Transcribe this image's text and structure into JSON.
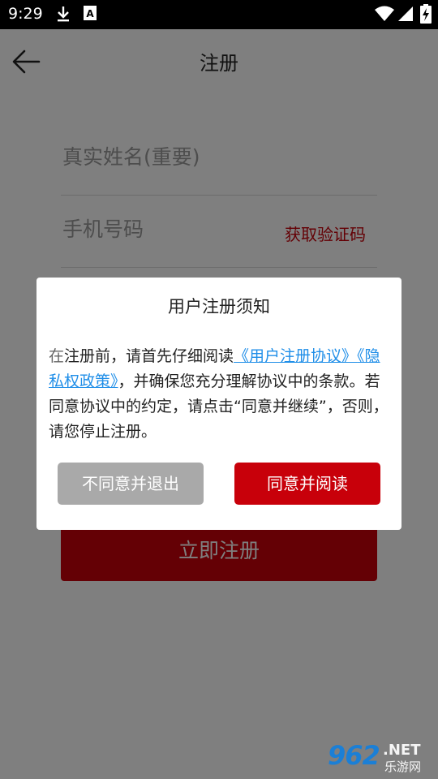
{
  "status_bar": {
    "time": "9:29",
    "icons": [
      "download-icon",
      "a11y-notification-icon",
      "wifi-icon",
      "signal-icon",
      "battery-charging-icon"
    ]
  },
  "app_bar": {
    "title": "注册",
    "back_icon": "arrow-left-icon"
  },
  "form": {
    "name_placeholder": "真实姓名(重要)",
    "phone_placeholder": "手机号码",
    "verify_label": "获取验证码",
    "register_label": "立即注册"
  },
  "dialog": {
    "title": "用户注册须知",
    "body_first_char": "在",
    "body_text_1": "注册前，请首先仔细阅读",
    "link_agreement": "《用户注册协议》",
    "link_privacy": "《隐私权政策》",
    "body_text_2": "，并确保您充分理解协议中的条款。若同意协议中的约定，请点击“同意并继续”，否则，请您停止注册。",
    "disagree_label": "不同意并退出",
    "agree_label": "同意并阅读"
  },
  "watermark": {
    "number": "962",
    "net": ".NET",
    "site": "乐游网"
  },
  "colors": {
    "accent": "#c8000a",
    "link": "#1f8ee8",
    "disabled": "#a9a9a9",
    "overlay": "rgba(0,0,0,0.5)"
  }
}
